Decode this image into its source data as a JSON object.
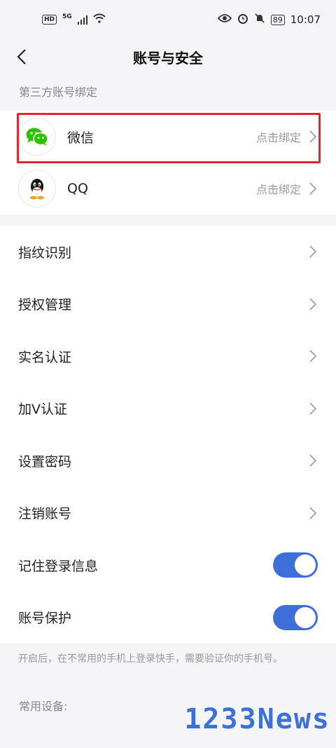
{
  "status_bar": {
    "hd": "HD",
    "signal_type": "5G",
    "battery": "89",
    "time": "10:07"
  },
  "header": {
    "title": "账号与安全"
  },
  "third_party": {
    "section_label": "第三方账号绑定",
    "items": [
      {
        "label": "微信",
        "hint": "点击绑定",
        "icon": "wechat-icon",
        "highlighted": true
      },
      {
        "label": "QQ",
        "hint": "点击绑定",
        "icon": "qq-icon"
      }
    ]
  },
  "settings": {
    "items": [
      {
        "label": "指纹识别"
      },
      {
        "label": "授权管理"
      },
      {
        "label": "实名认证"
      },
      {
        "label": "加V认证"
      },
      {
        "label": "设置密码"
      },
      {
        "label": "注销账号"
      }
    ],
    "toggles": [
      {
        "label": "记住登录信息",
        "on": true
      },
      {
        "label": "账号保护",
        "on": true
      }
    ]
  },
  "note": "开启后，在不常用的手机上登录快手，需要验证你的手机号。",
  "devices_label": "常用设备:",
  "watermark": "1233News",
  "colors": {
    "accent": "#3e6fd8",
    "highlight": "#e3262b",
    "wechat": "#2dc100"
  }
}
